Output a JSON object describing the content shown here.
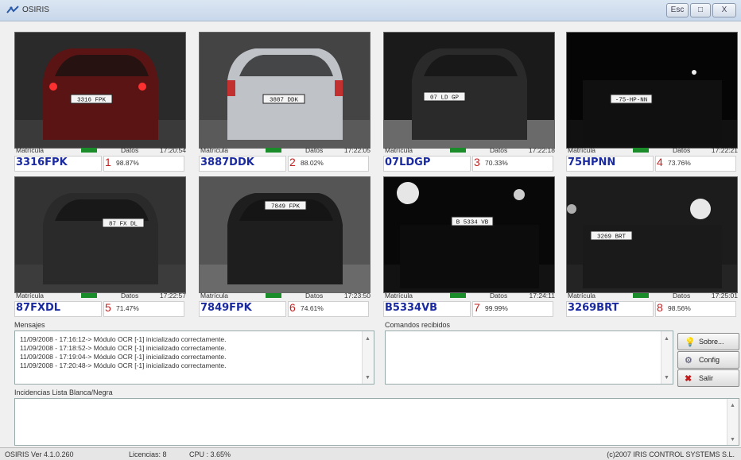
{
  "window": {
    "title": "OSIRIS",
    "controls": {
      "minimize": "Esc",
      "maximize": "□",
      "close": "X"
    }
  },
  "cameras": [
    {
      "label": "Matrícula",
      "data_label": "Datos",
      "time": "17:20:54",
      "plate": "3316FPK",
      "index": "1",
      "confidence": "98.87%",
      "plate_on_image": "3316 FPK"
    },
    {
      "label": "Matrícula",
      "data_label": "Datos",
      "time": "17:22:05",
      "plate": "3887DDK",
      "index": "2",
      "confidence": "88.02%",
      "plate_on_image": "3887 DDK"
    },
    {
      "label": "Matrícula",
      "data_label": "Datos",
      "time": "17:22:18",
      "plate": "07LDGP",
      "index": "3",
      "confidence": "70.33%",
      "plate_on_image": "07 LD GP"
    },
    {
      "label": "Matrícula",
      "data_label": "Datos",
      "time": "17:22:21",
      "plate": "75HPNN",
      "index": "4",
      "confidence": "73.76%",
      "plate_on_image": "-75-HP-NN"
    },
    {
      "label": "Matrícula",
      "data_label": "Datos",
      "time": "17:22:57",
      "plate": "87FXDL",
      "index": "5",
      "confidence": "71.47%",
      "plate_on_image": "87 FX DL"
    },
    {
      "label": "Matrícula",
      "data_label": "Datos",
      "time": "17:23:50",
      "plate": "7849FPK",
      "index": "6",
      "confidence": "74.61%",
      "plate_on_image": "7849 FPK"
    },
    {
      "label": "Matrícula",
      "data_label": "Datos",
      "time": "17:24:11",
      "plate": "B5334VB",
      "index": "7",
      "confidence": "99.99%",
      "plate_on_image": "B 5334 VB"
    },
    {
      "label": "Matrícula",
      "data_label": "Datos",
      "time": "17:25:01",
      "plate": "3269BRT",
      "index": "8",
      "confidence": "98.56%",
      "plate_on_image": "3269 BRT"
    }
  ],
  "messages": {
    "label": "Mensajes",
    "lines": [
      "11/09/2008 - 17:16:12-> Módulo OCR [-1] inicializado correctamente.",
      "11/09/2008 - 17:18:52-> Módulo OCR [-1] inicializado correctamente.",
      "11/09/2008 - 17:19:04-> Módulo OCR [-1] inicializado correctamente.",
      "11/09/2008 - 17:20:48-> Módulo OCR [-1] inicializado correctamente."
    ]
  },
  "commands": {
    "label": "Comandos recibidos"
  },
  "buttons": {
    "about": "Sobre...",
    "config": "Config",
    "exit": "Salir"
  },
  "incidents": {
    "label": "Incidencias Lista Blanca/Negra"
  },
  "status": {
    "version": "OSIRIS  Ver 4.1.0.260",
    "licenses": "Licencias: 8",
    "cpu": "CPU : 3.65%",
    "copyright": "(c)2007 IRIS CONTROL SYSTEMS S.L."
  },
  "colors": {
    "plate_text": "#1a2aa0",
    "index_text": "#c62020",
    "status_led": "#1a8c2a"
  }
}
